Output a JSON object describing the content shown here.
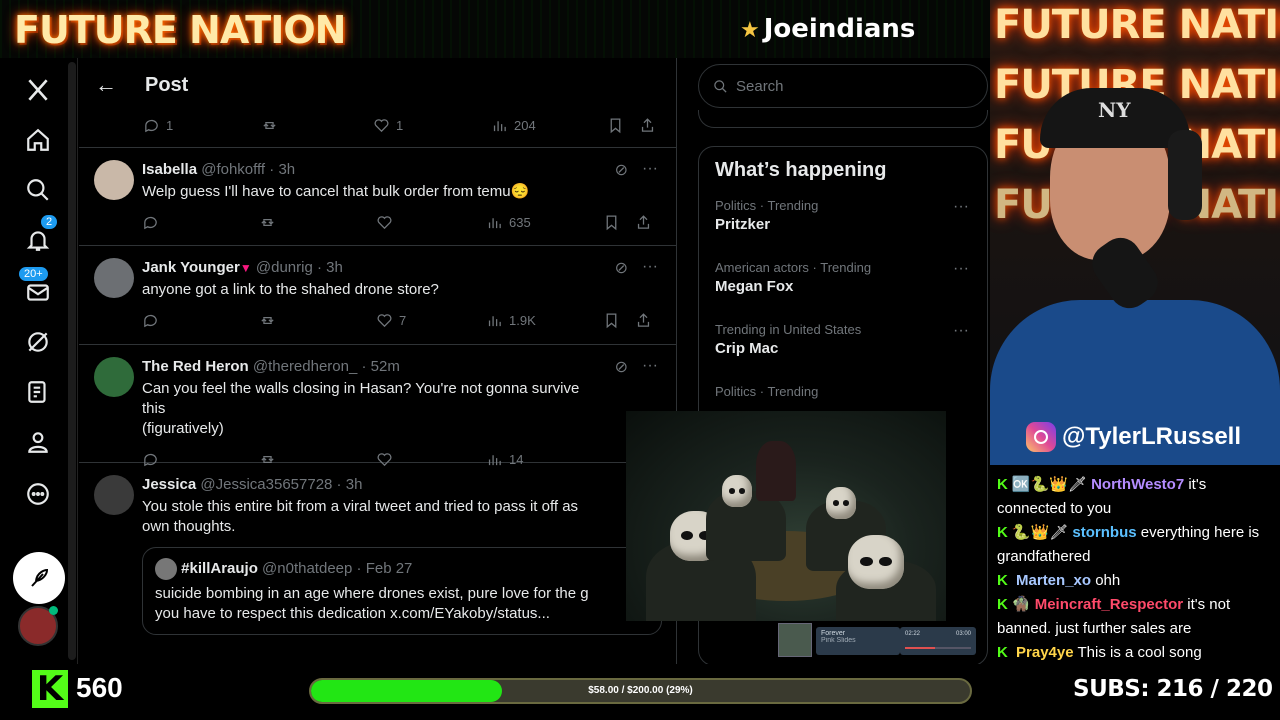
{
  "banner": {
    "brand": "FUTURE NATION",
    "team": "Joeindians"
  },
  "nav": {
    "notif_badge": "2",
    "messages_badge": "20+"
  },
  "post_header": {
    "title": "Post"
  },
  "top_actions": {
    "replies": "1",
    "reposts": "",
    "likes": "1",
    "views": "204"
  },
  "tweets": [
    {
      "name": "Isabella",
      "handle": "@fohkofff",
      "time": "3h",
      "text": "Welp guess I'll have to cancel that bulk order from temu😔",
      "replies": "",
      "reposts": "",
      "likes": "",
      "views": "635"
    },
    {
      "name": "Jank Younger",
      "handle": "@dunrig",
      "time": "3h",
      "text": "anyone got a link to the shahed drone store?",
      "replies": "",
      "reposts": "",
      "likes": "7",
      "views": "1.9K"
    },
    {
      "name": "The Red Heron",
      "handle": "@theredheron_",
      "time": "52m",
      "text": "Can you feel the walls closing in Hasan? You're not gonna survive this\n(figuratively)",
      "replies": "",
      "reposts": "",
      "likes": "",
      "views": "14"
    },
    {
      "name": "Jessica",
      "handle": "@Jessica35657728",
      "time": "3h",
      "text": "You stole this entire bit from a viral tweet and tried to pass it off as\nown thoughts.",
      "quote": {
        "name": "#killAraujo",
        "handle": "@n0thatdeep",
        "time": "Feb 27",
        "text": "suicide bombing in an age where drones exist, pure love for the g\nyou have to respect this dedication x.com/EYakoby/status..."
      }
    }
  ],
  "sidebar": {
    "search_placeholder": "Search",
    "happening_title": "What’s happening",
    "trends": [
      {
        "context": "Politics · Trending",
        "name": "Pritzker"
      },
      {
        "context": "American actors · Trending",
        "name": "Megan Fox"
      },
      {
        "context": "Trending in United States",
        "name": "Crip Mac"
      },
      {
        "context": "Politics · Trending",
        "name": ""
      }
    ]
  },
  "music": {
    "title": "Forever",
    "artist": "Pink Slides",
    "elapsed": "02:22",
    "total": "03:00",
    "progress": 0.45
  },
  "webcam": {
    "instagram": "@TylerLRussell",
    "cap_logo": "NY"
  },
  "chat": [
    {
      "user": "NorthWesto7",
      "color": "#b48cff",
      "badges": "🆗🐍👑🗡",
      "msg": "it's connected to you"
    },
    {
      "user": "stornbus",
      "color": "#5bc0ff",
      "badges": "🐍👑🗡",
      "msg": "everything here is grandfathered"
    },
    {
      "user": "Marten_xo",
      "color": "#a8c8ff",
      "badges": "",
      "msg": "ohh"
    },
    {
      "user": "Meincraft_Respector",
      "color": "#ff4a6a",
      "badges": "🧌",
      "msg": "it's not banned. just further sales are"
    },
    {
      "user": "Pray4ye",
      "color": "#ffd54a",
      "badges": "",
      "msg": "This is a cool song"
    }
  ],
  "bottom": {
    "kick_count": "560",
    "goal_text": "$58.00 / $200.00 (29%)",
    "goal_fraction": 0.29,
    "subs_text": "SUBS:  216 / 220"
  },
  "colors": {
    "accent": "#1d9bf0",
    "kick_green": "#53fc18"
  }
}
